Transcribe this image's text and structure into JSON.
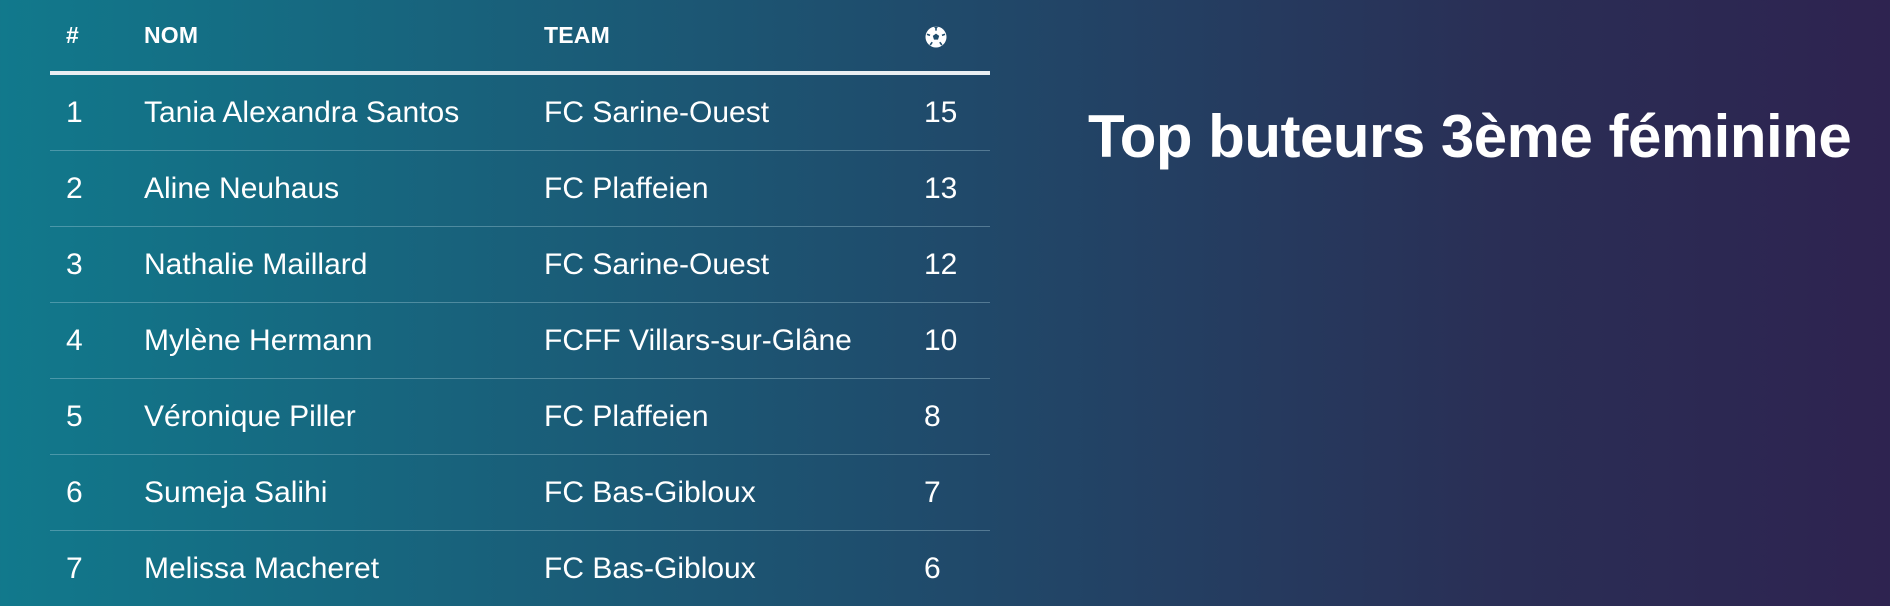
{
  "table": {
    "headers": {
      "rank": "#",
      "name": "NOM",
      "team": "TEAM",
      "goals_icon": "soccer-ball-icon"
    },
    "rows": [
      {
        "rank": "1",
        "name": "Tania Alexandra Santos",
        "team": "FC Sarine-Ouest",
        "goals": "15"
      },
      {
        "rank": "2",
        "name": "Aline Neuhaus",
        "team": "FC Plaffeien",
        "goals": "13"
      },
      {
        "rank": "3",
        "name": "Nathalie Maillard",
        "team": "FC Sarine-Ouest",
        "goals": "12"
      },
      {
        "rank": "4",
        "name": "Mylène Hermann",
        "team": "FCFF Villars-sur-Glâne",
        "goals": "10"
      },
      {
        "rank": "5",
        "name": "Véronique Piller",
        "team": "FC Plaffeien",
        "goals": "8"
      },
      {
        "rank": "6",
        "name": "Sumeja Salihi",
        "team": "FC Bas-Gibloux",
        "goals": "7"
      },
      {
        "rank": "7",
        "name": "Melissa Macheret",
        "team": "FC Bas-Gibloux",
        "goals": "6"
      }
    ]
  },
  "title": "Top buteurs 3ème féminine",
  "colors": {
    "gradient_start": "#11798c",
    "gradient_end": "#2e2350",
    "text": "#ffffff",
    "header_rule": "#e9eef2"
  }
}
